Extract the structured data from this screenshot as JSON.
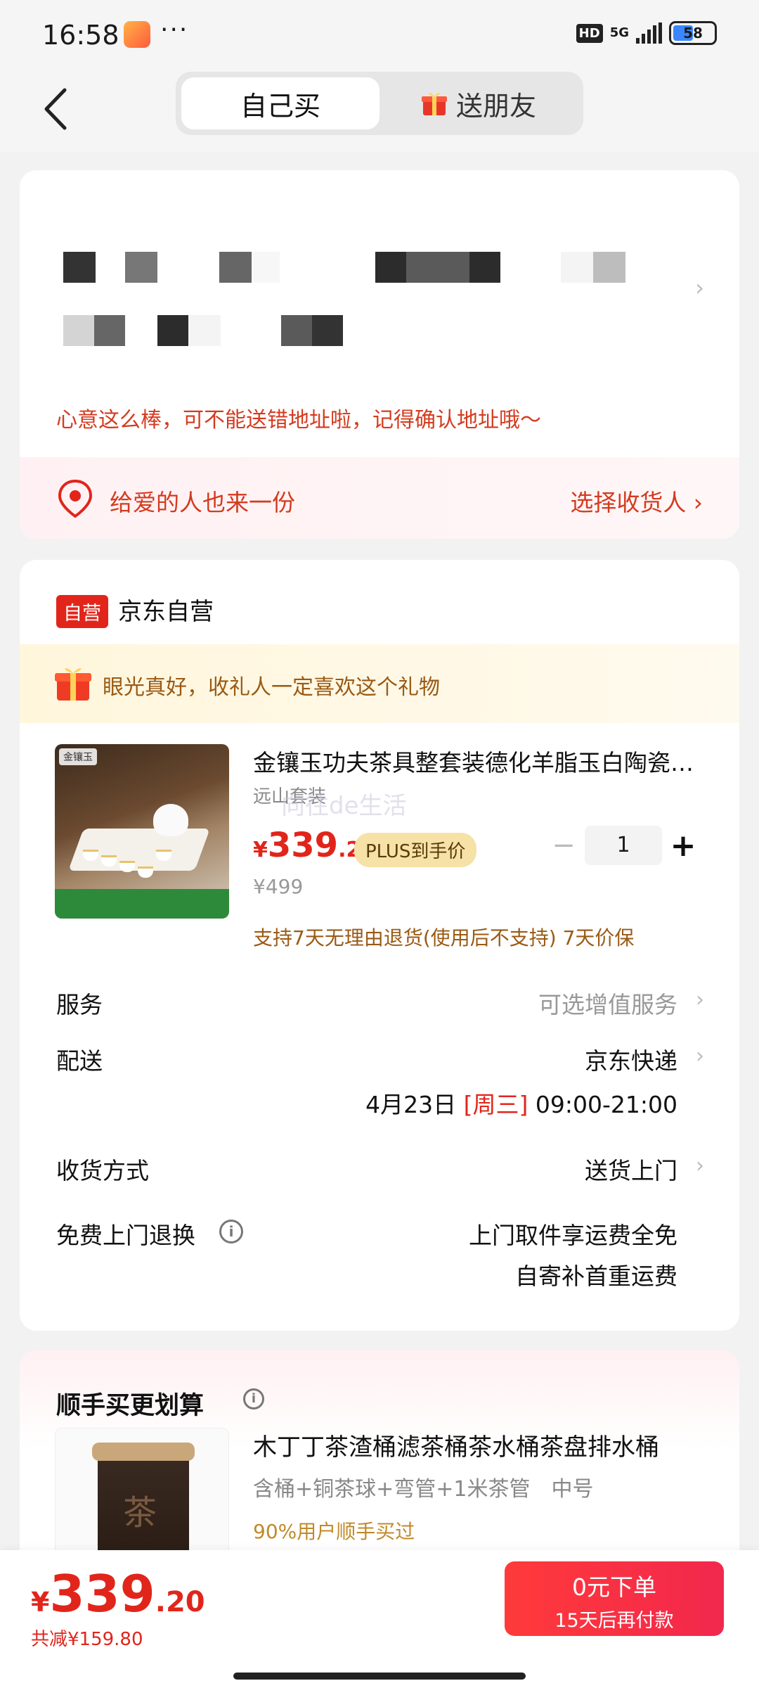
{
  "status_bar": {
    "time": "16:58",
    "hd": "HD",
    "network": "5G",
    "battery": "58"
  },
  "header": {
    "tabs": [
      {
        "label": "自己买"
      },
      {
        "label": "送朋友"
      }
    ]
  },
  "address": {
    "tip": "心意这么棒，可不能送错地址啦，记得确认地址哦～",
    "gift_row_label": "给爱的人也来一份",
    "gift_row_action": "选择收货人 ›"
  },
  "shop": {
    "badge": "自营",
    "name": "京东自营"
  },
  "praise": "眼光真好，收礼人一定喜欢这个礼物",
  "product": {
    "title": "金镶玉功夫茶具整套装德化羊脂玉白陶瓷茶杯茶壶",
    "spec": "远山套装",
    "watermark": "向往de生活",
    "price_currency": "¥",
    "price_int": "339",
    "price_dec": ".2",
    "plus_badge": "PLUS到手价",
    "original_price": "¥499",
    "quantity": "1",
    "minus": "−",
    "plus": "+",
    "return_policy": "支持7天无理由退货(使用后不支持) 7天价保",
    "image_logo": "金镶玉"
  },
  "rows": {
    "service_label": "服务",
    "service_value": "可选增值服务",
    "delivery_label": "配送",
    "delivery_value": "京东快递",
    "delivery_date": "4月23日",
    "delivery_weekday": "[周三]",
    "delivery_time": "09:00-21:00",
    "receive_label": "收货方式",
    "receive_value": "送货上门",
    "free_return_label": "免费上门退换",
    "free_return_line1": "上门取件享运费全免",
    "free_return_line2": "自寄补首重运费",
    "chevron": "›"
  },
  "recommend": {
    "title": "顺手买更划算",
    "name": "木丁丁茶渣桶滤茶桶茶水桶茶盘排水桶",
    "spec": "含桶+铜茶球+弯管+1米茶管　中号",
    "social": "90%用户顺手买过",
    "image_char": "茶"
  },
  "bottom": {
    "currency": "¥",
    "total_int": "339",
    "total_dec": ".20",
    "saved": "共减¥159.80",
    "order_main": "0元下单",
    "order_sub": "15天后再付款"
  },
  "colors": {
    "accent": "#e1251b",
    "gold": "#9a5a14",
    "plus_bg": "#f6e2a6"
  }
}
